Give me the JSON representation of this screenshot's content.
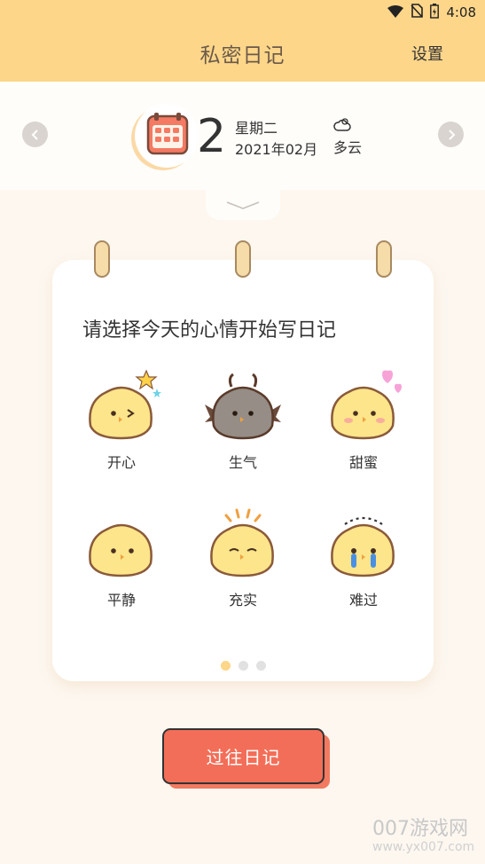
{
  "status_bar": {
    "time": "4:08"
  },
  "header": {
    "title": "私密日记",
    "settings_label": "设置"
  },
  "date": {
    "day": "2",
    "weekday": "星期二",
    "year_month": "2021年02月",
    "weather": "多云"
  },
  "card": {
    "prompt": "请选择今天的心情开始写日记",
    "moods": [
      {
        "label": "开心",
        "icon": "happy-chick-icon"
      },
      {
        "label": "生气",
        "icon": "angry-chick-icon"
      },
      {
        "label": "甜蜜",
        "icon": "sweet-chick-icon"
      },
      {
        "label": "平静",
        "icon": "calm-chick-icon"
      },
      {
        "label": "充实",
        "icon": "fulfilled-chick-icon"
      },
      {
        "label": "难过",
        "icon": "sad-chick-icon"
      }
    ],
    "page_count": 3,
    "active_page": 1
  },
  "history_button": {
    "label": "过往日记"
  },
  "watermark": {
    "line1": "007游戏网",
    "line2": "www.yx007.com"
  },
  "colors": {
    "header_bg": "#fdd68a",
    "page_bg": "#fdf7f0",
    "button": "#f36e58",
    "chick": "#fce58a",
    "chick_outline": "#8a5a3a"
  }
}
